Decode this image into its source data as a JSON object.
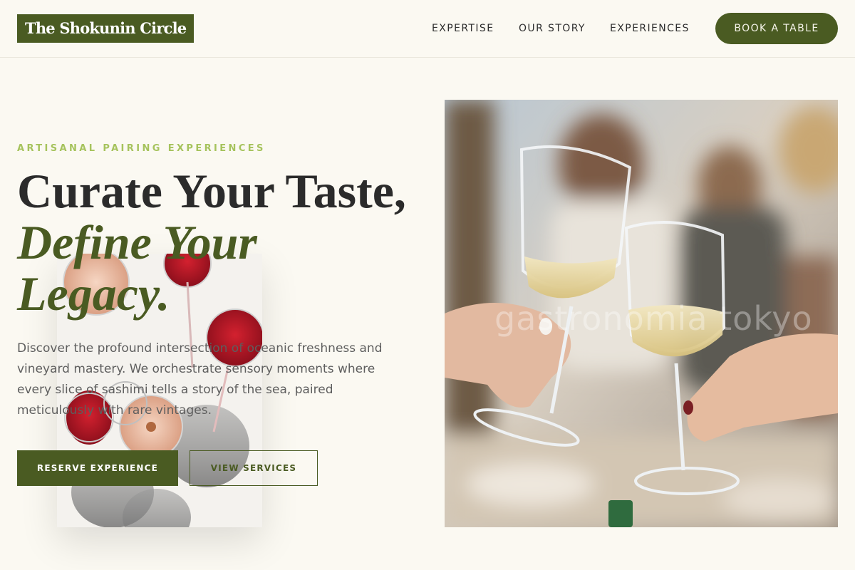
{
  "brand": {
    "logo_text": "The Shokunin Circle",
    "primary_color": "#4a5b22",
    "accent_color": "#a6c35d",
    "background": "#fbf9f2"
  },
  "nav": {
    "items": [
      {
        "label": "EXPERTISE"
      },
      {
        "label": "OUR STORY"
      },
      {
        "label": "EXPERIENCES"
      }
    ],
    "cta_label": "BOOK A TABLE"
  },
  "hero": {
    "eyebrow": "ARTISANAL PAIRING EXPERIENCES",
    "headline_line1": "Curate Your Taste,",
    "headline_line2": "Define Your",
    "headline_line3": "Legacy.",
    "lede": "Discover the profound intersection of oceanic freshness and vineyard mastery. We orchestrate sensory moments where every slice of sashimi tells a story of the sea, paired meticulously with rare vintages.",
    "primary_button": "RESERVE EXPERIENCE",
    "secondary_button": "VIEW SERVICES",
    "main_photo_watermark": "gastronomia tokyo"
  }
}
